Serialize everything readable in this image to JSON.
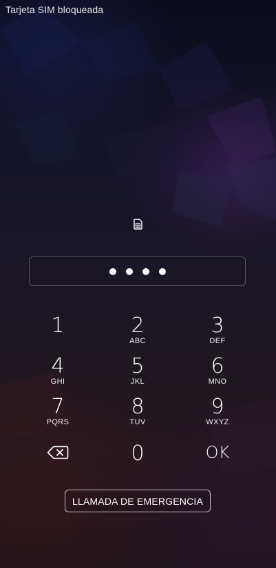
{
  "status_bar": {
    "sim_status": "Tarjeta SIM bloqueada"
  },
  "sim_icon": "sim-card-icon",
  "pin_entry": {
    "entered_digits": 4
  },
  "keypad": {
    "rows": [
      [
        {
          "digit": "1",
          "letters": ""
        },
        {
          "digit": "2",
          "letters": "ABC"
        },
        {
          "digit": "3",
          "letters": "DEF"
        }
      ],
      [
        {
          "digit": "4",
          "letters": "GHI"
        },
        {
          "digit": "5",
          "letters": "JKL"
        },
        {
          "digit": "6",
          "letters": "MNO"
        }
      ],
      [
        {
          "digit": "7",
          "letters": "PQRS"
        },
        {
          "digit": "8",
          "letters": "TUV"
        },
        {
          "digit": "9",
          "letters": "WXYZ"
        }
      ],
      [
        {
          "icon": "backspace-icon"
        },
        {
          "digit": "0",
          "letters": ""
        },
        {
          "label": "OK"
        }
      ]
    ]
  },
  "emergency_button": {
    "label": "LLAMADA DE EMERGENCIA"
  }
}
